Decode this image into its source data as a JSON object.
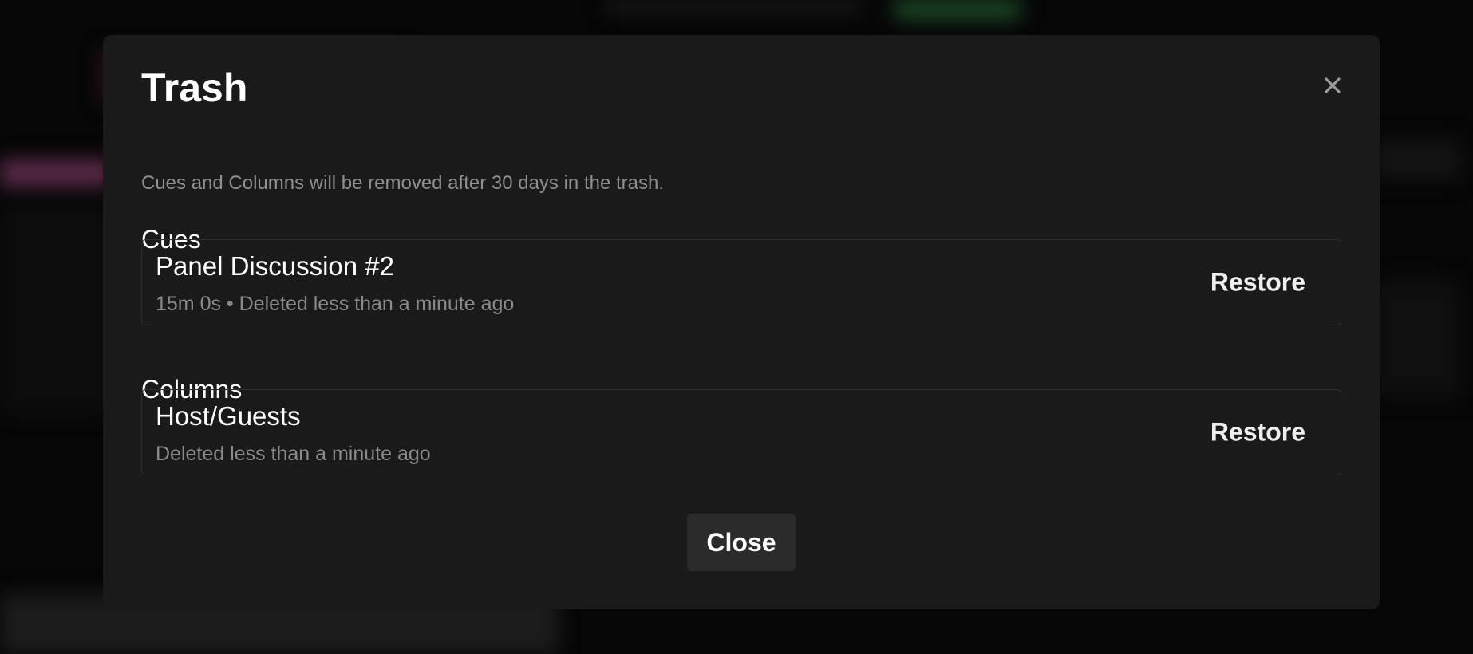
{
  "dialog": {
    "title": "Trash",
    "close_icon": "close-icon",
    "description": "Cues and Columns will be removed after 30 days in the trash.",
    "footer_close_label": "Close"
  },
  "sections": {
    "cues": {
      "heading": "Cues",
      "items": [
        {
          "name": "Panel Discussion #2",
          "meta": "15m 0s • Deleted less than a minute ago",
          "action_label": "Restore"
        }
      ]
    },
    "columns": {
      "heading": "Columns",
      "items": [
        {
          "name": "Host/Guests",
          "meta": "Deleted less than a minute ago",
          "action_label": "Restore"
        }
      ]
    }
  },
  "colors": {
    "backdrop": "#060606",
    "dialog_bg": "#1a1a1a",
    "card_border": "#2e2e2e",
    "muted_text": "#8f8f8f",
    "button_bg": "#2b2b2b"
  }
}
